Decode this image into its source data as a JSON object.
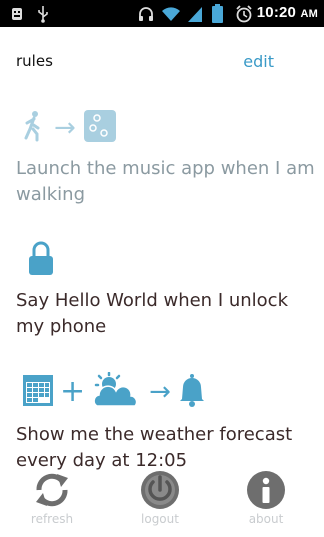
{
  "status_bar": {
    "time": "10:20",
    "ampm": "AM",
    "icons": [
      "usb-debug-icon",
      "usb-icon",
      "headphones-icon",
      "wifi-icon",
      "signal-icon",
      "battery-icon",
      "alarm-icon"
    ]
  },
  "header": {
    "title": "rules",
    "edit_label": "edit"
  },
  "rules": [
    {
      "text": "Launch the music app when I am walking",
      "state": "inactive",
      "icons": [
        "walking-icon",
        "arrow-right-icon",
        "music-app-icon"
      ]
    },
    {
      "text": "Say Hello World when I unlock my phone",
      "state": "active",
      "icons": [
        "lock-icon"
      ]
    },
    {
      "text": "Show me the weather forecast every day at 12:05",
      "state": "active",
      "icons": [
        "calendar-icon",
        "plus-icon",
        "weather-icon",
        "arrow-right-icon",
        "bell-icon"
      ]
    }
  ],
  "bottom_bar": {
    "buttons": [
      {
        "label": "refresh",
        "icon": "refresh-icon"
      },
      {
        "label": "logout",
        "icon": "power-icon"
      },
      {
        "label": "about",
        "icon": "info-icon"
      }
    ]
  },
  "colors": {
    "accent": "#3a9ac7",
    "icon_blue": "#4aa2c8",
    "icon_light": "#a9cfe0",
    "muted_text": "#8b9aa1",
    "dark_text": "#3b2a2a"
  }
}
